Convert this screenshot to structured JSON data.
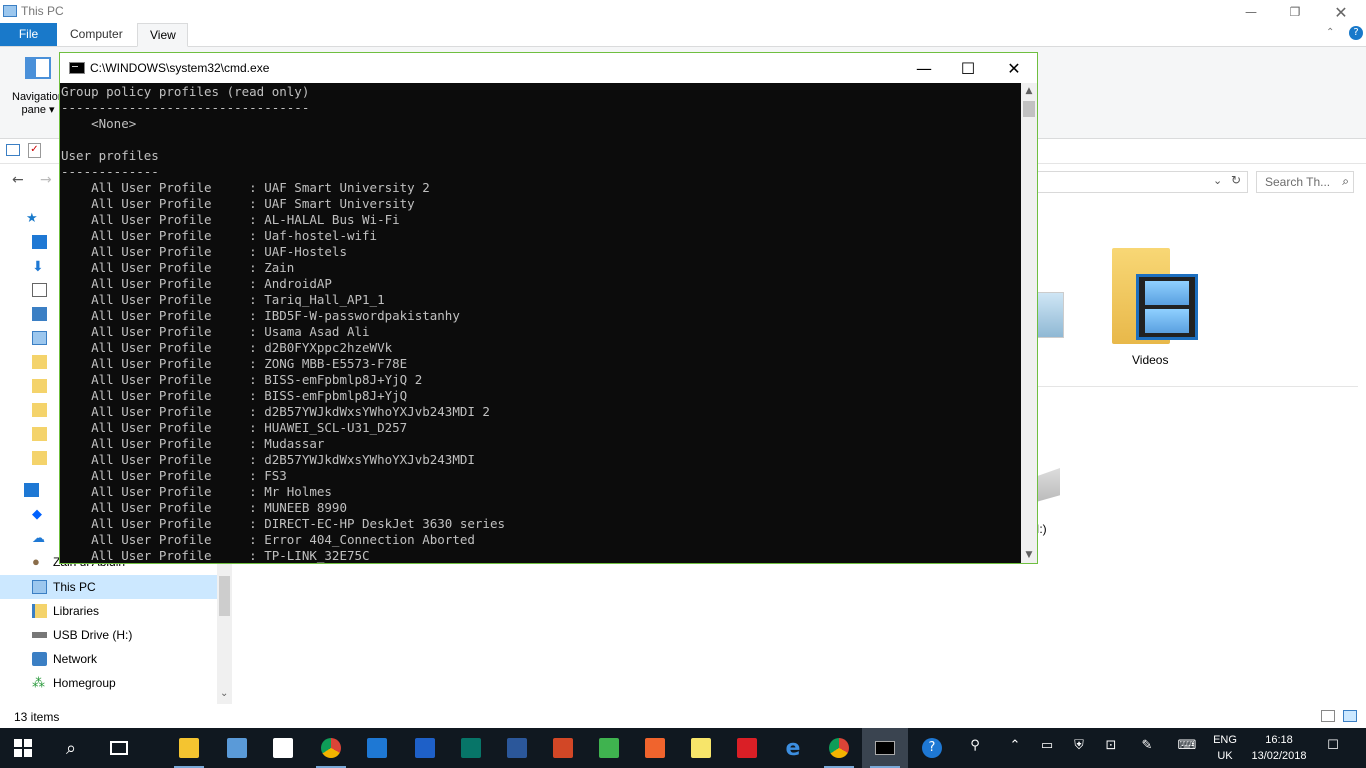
{
  "explorer": {
    "title": "This PC",
    "tabs": {
      "file": "File",
      "computer": "Computer",
      "view": "View"
    },
    "ribbon": {
      "navigation_pane": "Navigation",
      "navigation_pane2": "pane ▾"
    },
    "search_placeholder": "Search Th...",
    "nav_items": {
      "this_pc": "This PC",
      "libraries": "Libraries",
      "usb_drive": "USB Drive (H:)",
      "network": "Network",
      "homegroup": "Homegroup",
      "user": "Zain ul Abidin"
    },
    "folder_videos": "Videos",
    "drive_label_fragment": "I:)",
    "status_count": "13 items"
  },
  "cmd": {
    "title": "C:\\WINDOWS\\system32\\cmd.exe",
    "lines": [
      "Group policy profiles (read only)",
      "---------------------------------",
      "    <None>",
      "",
      "User profiles",
      "-------------",
      "    All User Profile     : UAF Smart University 2",
      "    All User Profile     : UAF Smart University",
      "    All User Profile     : AL-HALAL Bus Wi-Fi",
      "    All User Profile     : Uaf-hostel-wifi",
      "    All User Profile     : UAF-Hostels",
      "    All User Profile     : Zain",
      "    All User Profile     : AndroidAP",
      "    All User Profile     : Tariq_Hall_AP1_1",
      "    All User Profile     : IBD5F-W-passwordpakistanhy",
      "    All User Profile     : Usama Asad Ali",
      "    All User Profile     : d2B0FYXppc2hzeWVk",
      "    All User Profile     : ZONG MBB-E5573-F78E",
      "    All User Profile     : BISS-emFpbmlp8J+YjQ 2",
      "    All User Profile     : BISS-emFpbmlp8J+YjQ",
      "    All User Profile     : d2B57YWJkdWxsYWhoYXJvb243MDI 2",
      "    All User Profile     : HUAWEI_SCL-U31_D257",
      "    All User Profile     : Mudassar",
      "    All User Profile     : d2B57YWJkdWxsYWhoYXJvb243MDI",
      "    All User Profile     : FS3",
      "    All User Profile     : Mr Holmes",
      "    All User Profile     : MUNEEB 8990",
      "    All User Profile     : DIRECT-EC-HP DeskJet 3630 series",
      "    All User Profile     : Error 404_Connection Aborted",
      "    All User Profile     : TP-LINK_32E75C"
    ]
  },
  "taskbar": {
    "language": "ENG",
    "language2": "UK",
    "time": "16:18",
    "date": "13/02/2018"
  },
  "colors": {
    "file_tab": "#1979ca",
    "cmd_border": "#6fbf40",
    "taskbar": "#101820",
    "selected": "#cce8ff"
  }
}
